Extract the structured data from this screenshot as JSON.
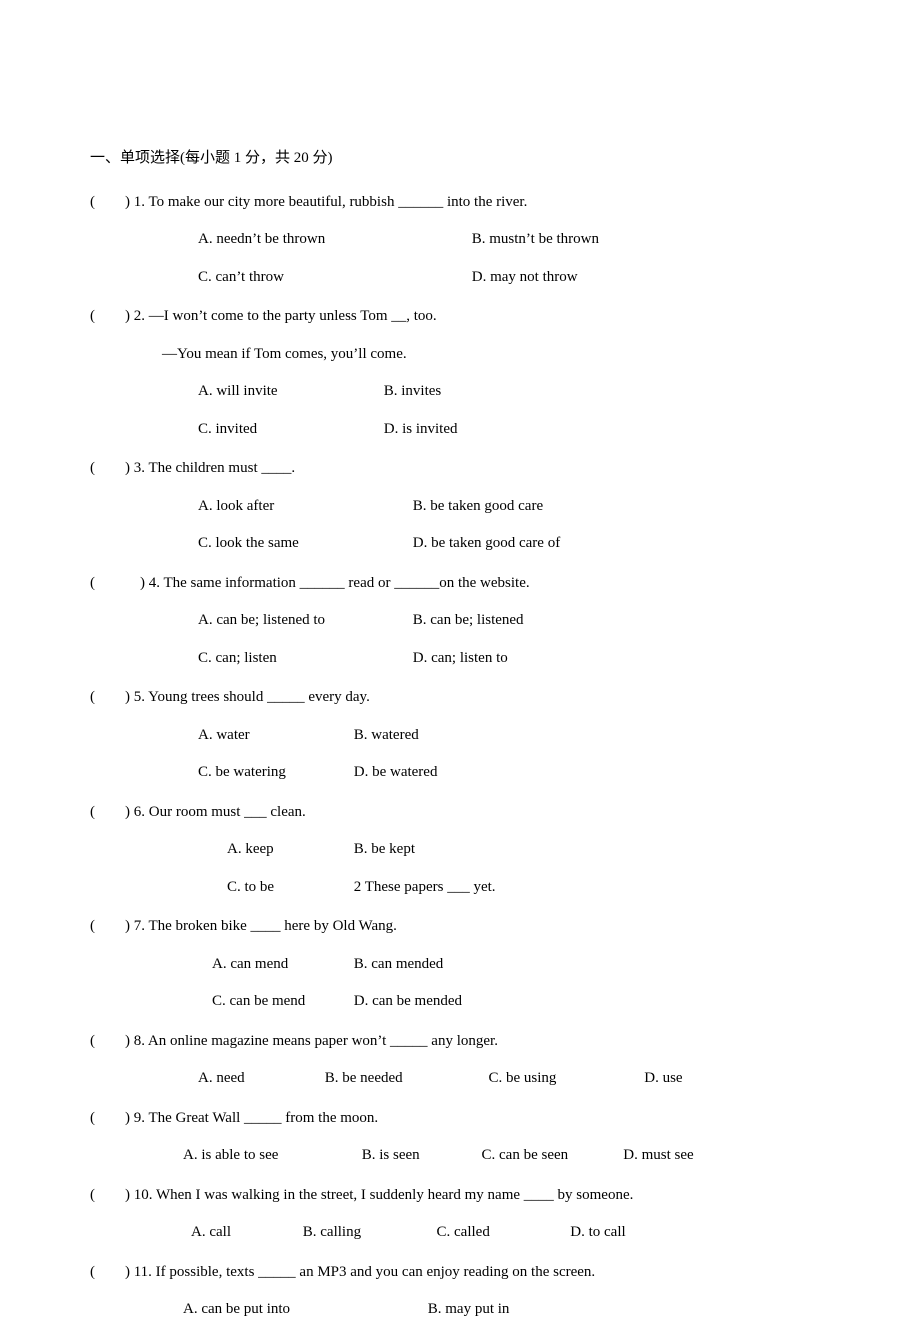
{
  "section_title": "一、单项选择(每小题 1 分，共 20 分)",
  "q1": {
    "stem": "(  ) 1. To make our city more beautiful, rubbish ______ into the river.",
    "A": "A. needn’t be thrown",
    "B": "B. mustn’t be thrown",
    "C": "C. can’t throw",
    "D": "D. may not throw"
  },
  "q2": {
    "stem": "(  ) 2. —I won’t come to the party unless Tom __, too.",
    "line2": "—You mean if Tom comes, you’ll come.",
    "A": "A. will invite",
    "B": "B. invites",
    "C": "C. invited",
    "D": "D. is invited"
  },
  "q3": {
    "stem": "(  ) 3. The children must ____.",
    "A": "A. look after",
    "B": "B. be taken good care",
    "C": "C. look the same",
    "D": "D. be taken good care of"
  },
  "q4": {
    "stem": "(   ) 4. The same information ______ read or ______on the website.",
    "A": "A. can be; listened to",
    "B": "B. can be; listened",
    "C": "C. can; listen",
    "D": "D. can; listen to"
  },
  "q5": {
    "stem": "(  ) 5. Young trees should _____ every day.",
    "A": "A. water",
    "B": "B. watered",
    "C": "C. be watering",
    "D": "D. be watered"
  },
  "q6": {
    "stem": "(  ) 6. Our room must ___ clean.",
    "A": "A. keep",
    "B": "B. be kept",
    "C": "C. to be",
    "D": "2 These papers ___ yet."
  },
  "q7": {
    "stem": "(  ) 7. The broken bike ____ here by Old Wang.",
    "A": "A. can mend",
    "B": "B. can mended",
    "C": "C. can be mend",
    "D": "D. can be mended"
  },
  "q8": {
    "stem": "(  ) 8. An online magazine means paper won’t _____ any longer.",
    "A": "A. need",
    "B": "B. be needed",
    "C": "C. be using",
    "D": "D. use"
  },
  "q9": {
    "stem": "(  ) 9. The Great Wall _____ from the moon.",
    "A": "A. is able to see",
    "B": "B. is seen",
    "C": "C. can be seen",
    "D": "D. must see"
  },
  "q10": {
    "stem": "(  ) 10. When I was walking in the street, I suddenly heard my name ____ by someone.",
    "A": "A. call",
    "B": "B. calling",
    "C": "C. called",
    "D": "D. to call"
  },
  "q11": {
    "stem": "(  ) 11. If possible, texts _____ an MP3 and you can enjoy reading on the screen.",
    "A": "A. can be put into",
    "B": "B. may put in"
  }
}
